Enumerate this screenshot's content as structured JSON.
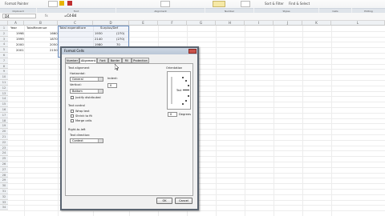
{
  "ribbon": {
    "items": [
      "Format Painter",
      "Clipboard",
      "Font",
      "Alignment",
      "Number",
      "Styles",
      "Cells",
      "Editing",
      "Sort & Filter",
      "Find & Select"
    ]
  },
  "formula_bar": {
    "name_box": "D4",
    "fx": "fx",
    "formula": "=C4-B4"
  },
  "columns": [
    "A",
    "B",
    "C",
    "D",
    "E",
    "F",
    "G",
    "H",
    "I",
    "J",
    "K",
    "L"
  ],
  "rows": [
    "1",
    "2",
    "3",
    "4",
    "5",
    "6",
    "7",
    "8",
    "9",
    "10",
    "11",
    "12",
    "13",
    "14",
    "15",
    "16",
    "17",
    "18",
    "19",
    "20",
    "21",
    "22",
    "23",
    "24",
    "25",
    "26",
    "27",
    "28",
    "29",
    "30",
    "31",
    "32",
    "33",
    "34"
  ],
  "sheet": {
    "headers": [
      "Year",
      "TotalRevenue",
      "Total expenditure",
      "Surplus/Def"
    ],
    "data": [
      [
        "1998",
        "1660",
        "1930",
        "(270)"
      ],
      [
        "1999",
        "1870",
        "2140",
        "(270)"
      ],
      [
        "2000",
        "2050",
        "1980",
        "70"
      ],
      [
        "2001",
        "2150",
        "2200",
        "(50)"
      ]
    ]
  },
  "dialog": {
    "title": "Format Cells",
    "tabs": [
      "Number",
      "Alignment",
      "Font",
      "Border",
      "Fill",
      "Protection"
    ],
    "active_tab": "Alignment",
    "text_alignment_label": "Text alignment",
    "horizontal_label": "Horizontal:",
    "horizontal_value": "General",
    "indent_label": "Indent:",
    "indent_value": "0",
    "vertical_label": "Vertical:",
    "vertical_value": "Bottom",
    "justify_distributed_label": "Justify distributed",
    "text_control_label": "Text control",
    "wrap_text_label": "Wrap text",
    "shrink_label": "Shrink to fit",
    "merge_label": "Merge cells",
    "rtl_label": "Right-to-left",
    "text_direction_label": "Text direction:",
    "text_direction_value": "Context",
    "orientation_label": "Orientation",
    "orientation_text": "Text",
    "degrees_value": "0",
    "degrees_label": "Degrees",
    "ok_label": "OK",
    "cancel_label": "Cancel"
  }
}
